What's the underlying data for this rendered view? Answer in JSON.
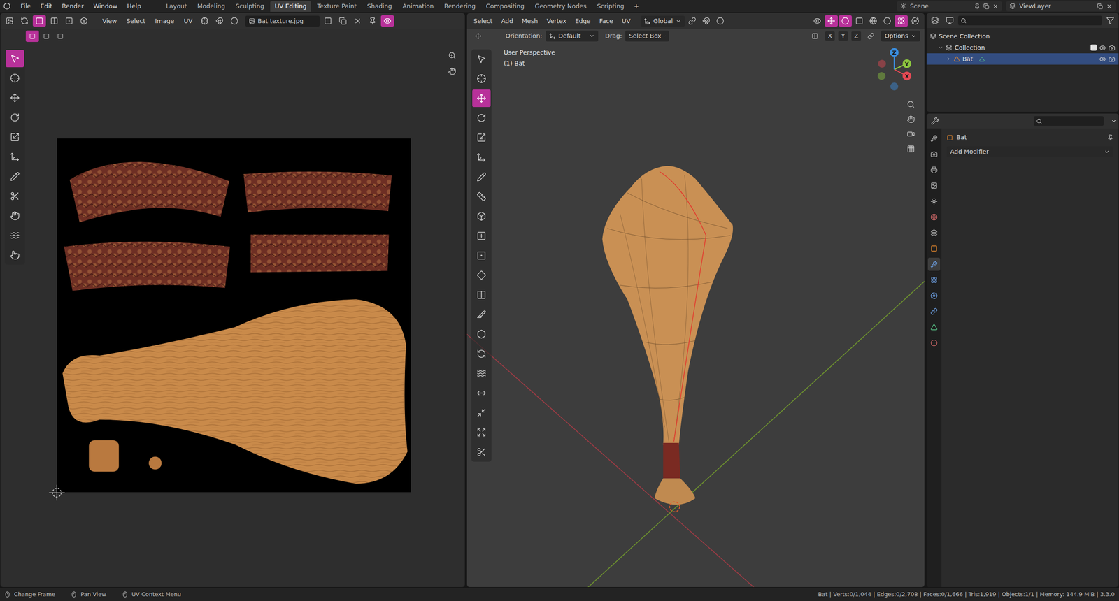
{
  "top_menu": [
    "File",
    "Edit",
    "Render",
    "Window",
    "Help"
  ],
  "workspaces": [
    {
      "label": "Layout",
      "selected": false
    },
    {
      "label": "Modeling",
      "selected": false
    },
    {
      "label": "Sculpting",
      "selected": false
    },
    {
      "label": "UV Editing",
      "selected": true
    },
    {
      "label": "Texture Paint",
      "selected": false
    },
    {
      "label": "Shading",
      "selected": false
    },
    {
      "label": "Animation",
      "selected": false
    },
    {
      "label": "Rendering",
      "selected": false
    },
    {
      "label": "Compositing",
      "selected": false
    },
    {
      "label": "Geometry Nodes",
      "selected": false
    },
    {
      "label": "Scripting",
      "selected": false
    }
  ],
  "add_workspace": "+",
  "scene": "Scene",
  "view_layer": "ViewLayer",
  "uv_editor": {
    "menus": [
      "View",
      "Select",
      "Image",
      "UV"
    ],
    "image_name": "Bat texture.jpg",
    "tools": [
      {
        "kind": "select",
        "selected": true
      },
      {
        "kind": "cursor",
        "selected": false
      },
      {
        "kind": "move",
        "selected": false
      },
      {
        "kind": "rotate",
        "selected": false
      },
      {
        "kind": "scale",
        "selected": false
      },
      {
        "kind": "transform",
        "selected": false
      },
      {
        "kind": "annotate",
        "selected": false
      },
      {
        "kind": "rip",
        "selected": false
      },
      {
        "kind": "grab",
        "selected": false
      },
      {
        "kind": "relax",
        "selected": false
      },
      {
        "kind": "pinch",
        "selected": false
      }
    ]
  },
  "viewport": {
    "menus": [
      "Select",
      "Add",
      "Mesh",
      "Vertex",
      "Edge",
      "Face",
      "UV"
    ],
    "transform_orientation": "Global",
    "orientation_label": "Orientation:",
    "orientation": "Default",
    "drag_label": "Drag:",
    "drag": "Select Box",
    "axes": [
      "X",
      "Y",
      "Z"
    ],
    "options": "Options",
    "perspective": "User Perspective",
    "active_object": "(1) Bat",
    "gizmo": [
      {
        "label": "X",
        "color": "#e54a55"
      },
      {
        "label": "Y",
        "color": "#8cc63f"
      },
      {
        "label": "Z",
        "color": "#3b8fe0"
      }
    ],
    "tools": [
      {
        "kind": "select",
        "selected": false
      },
      {
        "kind": "cursor",
        "selected": false
      },
      {
        "kind": "move",
        "selected": true
      },
      {
        "kind": "rotate",
        "selected": false
      },
      {
        "kind": "scale",
        "selected": false
      },
      {
        "kind": "transform",
        "selected": false
      },
      {
        "kind": "annotate",
        "selected": false
      },
      {
        "kind": "measure",
        "selected": false
      },
      {
        "kind": "add-cube",
        "selected": false
      },
      {
        "kind": "extrude",
        "selected": false
      },
      {
        "kind": "inset",
        "selected": false
      },
      {
        "kind": "bevel",
        "selected": false
      },
      {
        "kind": "loopcut",
        "selected": false
      },
      {
        "kind": "knife",
        "selected": false
      },
      {
        "kind": "polybuild",
        "selected": false
      },
      {
        "kind": "spin",
        "selected": false
      },
      {
        "kind": "smooth",
        "selected": false
      },
      {
        "kind": "edge-slide",
        "selected": false
      },
      {
        "kind": "shrink",
        "selected": false
      },
      {
        "kind": "shear",
        "selected": false
      },
      {
        "kind": "rip",
        "selected": false
      }
    ]
  },
  "outliner": {
    "rows": [
      {
        "label": "Scene Collection",
        "depth": 0,
        "selected": false,
        "kind": "scene"
      },
      {
        "label": "Collection",
        "depth": 1,
        "selected": false,
        "kind": "collection",
        "checked": true
      },
      {
        "label": "Bat",
        "depth": 2,
        "selected": true,
        "kind": "object"
      }
    ]
  },
  "properties": {
    "object_name": "Bat",
    "add_modifier": "Add Modifier",
    "tabs": [
      {
        "kind": "tool",
        "selected": false
      },
      {
        "kind": "render",
        "selected": false
      },
      {
        "kind": "output",
        "selected": false
      },
      {
        "kind": "view",
        "selected": false
      },
      {
        "kind": "scene",
        "selected": false
      },
      {
        "kind": "world",
        "selected": false
      },
      {
        "kind": "collection",
        "selected": false
      },
      {
        "kind": "object",
        "selected": false
      },
      {
        "kind": "modifiers",
        "selected": true
      },
      {
        "kind": "particles",
        "selected": false
      },
      {
        "kind": "physics",
        "selected": false
      },
      {
        "kind": "constraints",
        "selected": false
      },
      {
        "kind": "data",
        "selected": false
      },
      {
        "kind": "material",
        "selected": false
      }
    ]
  },
  "status_bar": {
    "hints": [
      {
        "kind": "left",
        "label": "Change Frame"
      },
      {
        "kind": "middle",
        "label": "Pan View"
      },
      {
        "kind": "right",
        "label": "UV Context Menu"
      }
    ],
    "stats": "Bat | Verts:0/1,044 | Edges:0/2,708 | Faces:0/1,666 | Tris:1,919 | Objects:1/1 | Memory: 144.9 MiB | 3.3.0"
  }
}
